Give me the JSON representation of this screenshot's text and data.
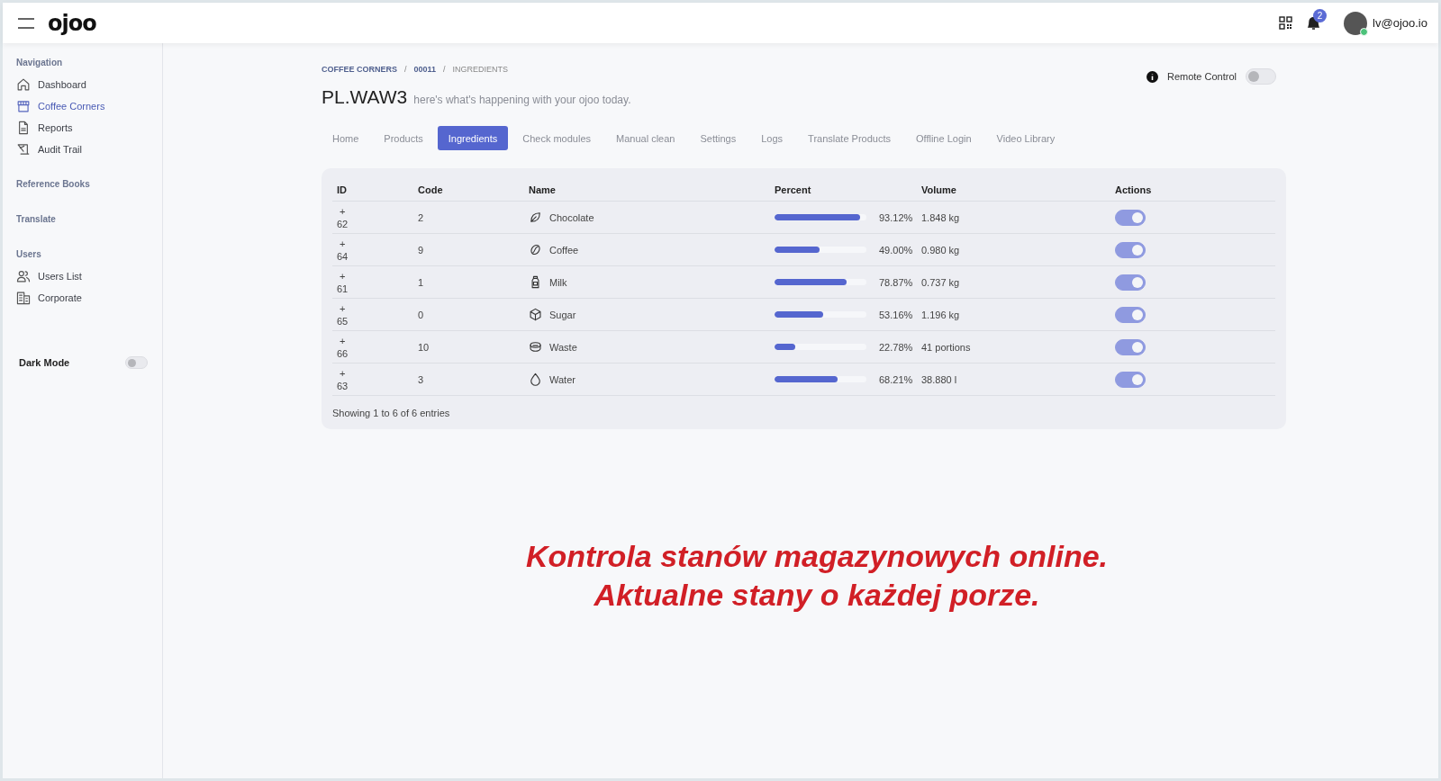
{
  "header": {
    "logo": "ojoo",
    "notifications_count": "2",
    "user_email": "lv@ojoo.io"
  },
  "sidebar": {
    "sections": [
      {
        "title": "Navigation",
        "items": [
          {
            "label": "Dashboard",
            "selected": false
          },
          {
            "label": "Coffee Corners",
            "selected": true
          },
          {
            "label": "Reports",
            "selected": false
          },
          {
            "label": "Audit Trail",
            "selected": false
          }
        ]
      },
      {
        "title": "Reference Books"
      },
      {
        "title": "Translate"
      },
      {
        "title": "Users",
        "items": [
          {
            "label": "Users List",
            "selected": false
          },
          {
            "label": "Corporate",
            "selected": false
          }
        ]
      }
    ],
    "dark_mode": {
      "label": "Dark Mode",
      "on": false
    }
  },
  "breadcrumb": [
    {
      "kind": "link",
      "label": "COFFEE CORNERS"
    },
    {
      "kind": "separator",
      "label": "/"
    },
    {
      "kind": "link",
      "label": "00011"
    },
    {
      "kind": "separator",
      "label": "/"
    },
    {
      "kind": "current",
      "label": "INGREDIENTS"
    }
  ],
  "page_title": "PL.WAW3",
  "page_subtitle": "here's what's happening with your ojoo today.",
  "remote_control": {
    "label": "Remote Control",
    "on": false
  },
  "tabs": [
    {
      "label": "Home",
      "selected": false
    },
    {
      "label": "Products",
      "selected": false
    },
    {
      "label": "Ingredients",
      "selected": true
    },
    {
      "label": "Check modules",
      "selected": false
    },
    {
      "label": "Manual clean",
      "selected": false
    },
    {
      "label": "Settings",
      "selected": false
    },
    {
      "label": "Logs",
      "selected": false
    },
    {
      "label": "Translate Products",
      "selected": false
    },
    {
      "label": "Offline Login",
      "selected": false
    },
    {
      "label": "Video Library",
      "selected": false
    }
  ],
  "table": {
    "columns": [
      "ID",
      "Code",
      "Name",
      "Percent",
      "Volume",
      "Actions"
    ],
    "rows": [
      {
        "expand": "+",
        "id": "62",
        "code": "2",
        "name": "Chocolate",
        "level": 0.9312,
        "percent": "93.12%",
        "volume": "1.848 kg",
        "on": true
      },
      {
        "expand": "+",
        "id": "64",
        "code": "9",
        "name": "Coffee",
        "level": 0.49,
        "percent": "49.00%",
        "volume": "0.980 kg",
        "on": true
      },
      {
        "expand": "+",
        "id": "61",
        "code": "1",
        "name": "Milk",
        "level": 0.7887,
        "percent": "78.87%",
        "volume": "0.737 kg",
        "on": true
      },
      {
        "expand": "+",
        "id": "65",
        "code": "0",
        "name": "Sugar",
        "level": 0.5316,
        "percent": "53.16%",
        "volume": "1.196 kg",
        "on": true
      },
      {
        "expand": "+",
        "id": "66",
        "code": "10",
        "name": "Waste",
        "level": 0.2278,
        "percent": "22.78%",
        "volume": "41 portions",
        "on": true
      },
      {
        "expand": "+",
        "id": "63",
        "code": "3",
        "name": "Water",
        "level": 0.6821,
        "percent": "68.21%",
        "volume": "38.880 l",
        "on": true
      }
    ],
    "footer": "Showing 1 to 6 of 6 entries"
  },
  "caption": [
    "Kontrola stanów magazynowych online.",
    "Aktualne stany o każdej porze."
  ]
}
